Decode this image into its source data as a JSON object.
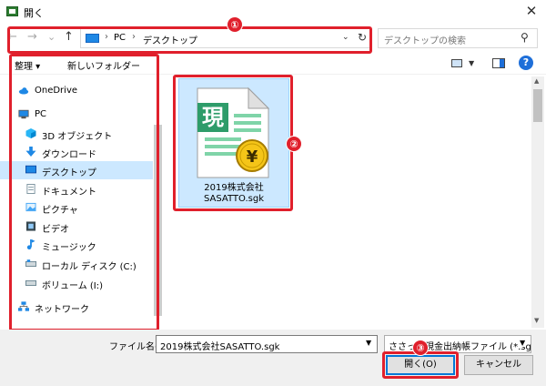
{
  "window": {
    "title": "開く",
    "close_glyph": "✕"
  },
  "address": {
    "back_glyph": "←",
    "forward_glyph": "→",
    "recent_glyph": "⌄",
    "up_glyph": "↑",
    "parts": [
      "PC",
      "デスクトップ"
    ],
    "separator": "›",
    "dropdown_glyph": "⌄",
    "refresh_glyph": "↻",
    "search_placeholder": "デスクトップの検索",
    "search_icon_glyph": "⚲"
  },
  "toolbar": {
    "organize": "整理 ▾",
    "new_folder": "新しいフォルダー",
    "view_dropdown_glyph": "▼",
    "help": "?"
  },
  "nav": {
    "items": [
      {
        "label": "OneDrive",
        "icon": "cloud-icon",
        "color": "#1e88e5"
      },
      {
        "label": "PC",
        "icon": "pc-icon",
        "color": "#1e88e5"
      },
      {
        "label": "3D オブジェクト",
        "icon": "cube-icon",
        "color": "#29b6f6"
      },
      {
        "label": "ダウンロード",
        "icon": "download-icon",
        "color": "#1e88e5"
      },
      {
        "label": "デスクトップ",
        "icon": "desktop-icon",
        "color": "#1e88e5",
        "selected": true
      },
      {
        "label": "ドキュメント",
        "icon": "document-icon",
        "color": "#90a4ae"
      },
      {
        "label": "ピクチャ",
        "icon": "picture-icon",
        "color": "#42a5f5"
      },
      {
        "label": "ビデオ",
        "icon": "video-icon",
        "color": "#37474f"
      },
      {
        "label": "ミュージック",
        "icon": "music-icon",
        "color": "#1e88e5"
      },
      {
        "label": "ローカル ディスク (C:)",
        "icon": "drive-icon",
        "color": "#607d8b"
      },
      {
        "label": "ボリューム (I:)",
        "icon": "drive-icon",
        "color": "#607d8b"
      },
      {
        "label": "ネットワーク",
        "icon": "network-icon",
        "color": "#1e88e5"
      }
    ]
  },
  "file": {
    "name_line1": "2019株式会社",
    "name_line2": "SASATTO.sgk",
    "icon_kanji": "現",
    "coin_symbol": "¥"
  },
  "bottom": {
    "filename_label": "ファイル名(N):",
    "filename_value": "2019株式会社SASATTO.sgk",
    "filetype_value": "ささっと現金出納帳ファイル (*.sgk)",
    "open_button": "開く(O)",
    "cancel_button": "キャンセル"
  },
  "callouts": [
    "①",
    "②",
    "③"
  ],
  "colors": {
    "callout": "#e0202c",
    "selection": "#cce8ff",
    "accent": "#0078d7"
  }
}
